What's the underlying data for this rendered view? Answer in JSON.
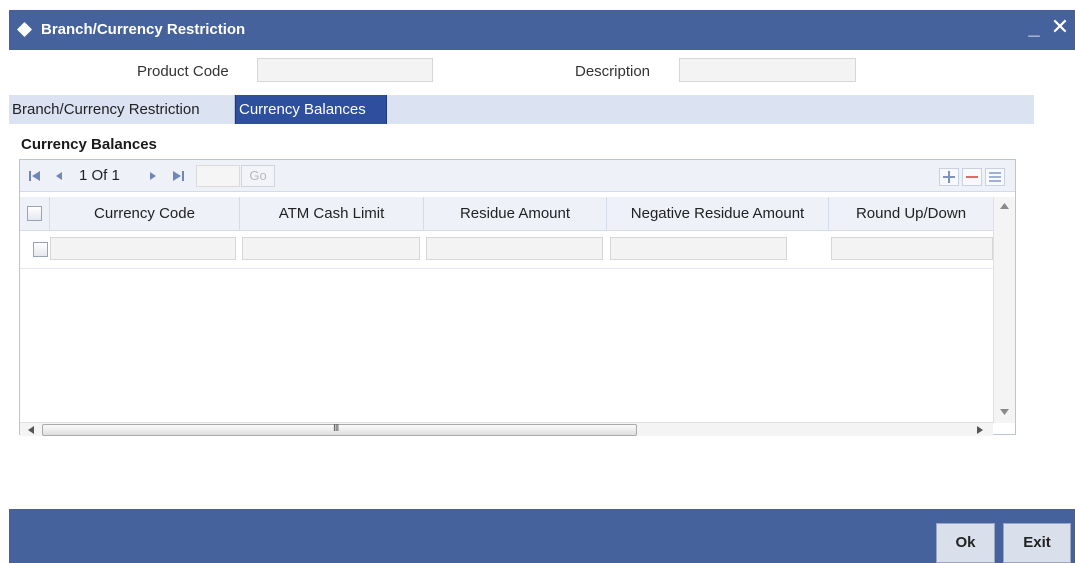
{
  "window": {
    "title": "Branch/Currency Restriction",
    "minimize_glyph": "_",
    "close_glyph": "✕"
  },
  "header": {
    "product_code_label": "Product Code",
    "product_code_value": "",
    "description_label": "Description",
    "description_value": ""
  },
  "tabs": [
    {
      "label": "Branch/Currency Restriction",
      "active": false
    },
    {
      "label": "Currency Balances",
      "active": true
    }
  ],
  "section": {
    "title": "Currency Balances"
  },
  "pager": {
    "page_text": "1 Of 1",
    "page_input": "",
    "go_label": "Go",
    "icons": [
      "first-page-icon",
      "prev-page-icon",
      "next-page-icon",
      "last-page-icon",
      "add-row-icon",
      "delete-row-icon",
      "view-list-icon"
    ]
  },
  "grid": {
    "columns": [
      "Currency Code",
      "ATM Cash Limit",
      "Residue Amount",
      "Negative Residue Amount",
      "Round Up/Down"
    ],
    "rows": [
      {
        "currency_code": "",
        "atm_cash_limit": "",
        "residue_amount": "",
        "negative_residue_amount": "",
        "round_up_down": ""
      }
    ],
    "hscroll_grip": "III"
  },
  "footer": {
    "ok_label": "Ok",
    "exit_label": "Exit"
  },
  "colors": {
    "titlebar": "#45629c",
    "active_tab": "#2d4f9e",
    "tabstrip": "#dbe3f3"
  }
}
